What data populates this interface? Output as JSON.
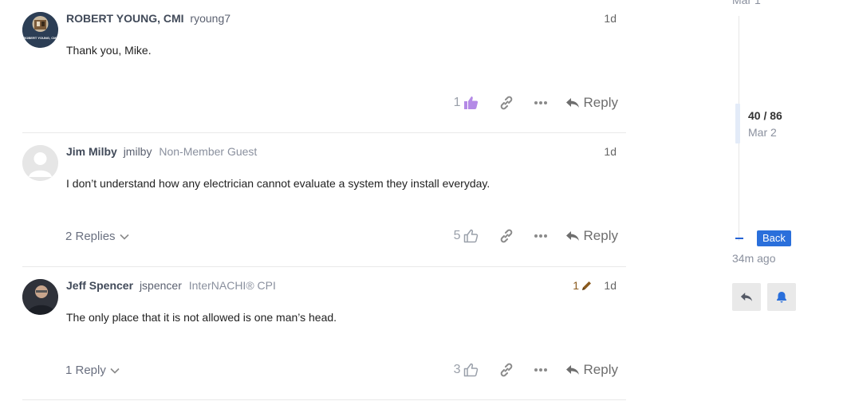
{
  "posts": [
    {
      "full_name": "ROBERT YOUNG, CMI",
      "username": "ryoung7",
      "title": "",
      "date": "1d",
      "avatar_text": "ROBERT YOUNG, CMI",
      "body": "Thank you, Mike.",
      "likes": "1",
      "liked": true,
      "replies": "",
      "reply_label": "Reply"
    },
    {
      "full_name": "Jim Milby",
      "username": "jmilby",
      "title": "Non-Member Guest",
      "date": "1d",
      "body": "I don’t understand how any electrician cannot evaluate a system they install everyday.",
      "likes": "5",
      "liked": false,
      "replies": "2 Replies",
      "reply_label": "Reply"
    },
    {
      "full_name": "Jeff Spencer",
      "username": "jspencer",
      "title": "InterNACHI® CPI",
      "date": "1d",
      "edits": "1",
      "body": "The only place that it is not allowed is one man’s head.",
      "likes": "3",
      "liked": false,
      "replies": "1 Reply",
      "reply_label": "Reply"
    }
  ],
  "timeline": {
    "start_date": "Mar 1",
    "position": "40 / 86",
    "position_date": "Mar 2",
    "back_label": "Back",
    "last_visit": "34m ago"
  },
  "colors": {
    "accent": "#2a6fdb",
    "liked": "#b48ae6",
    "muted": "#9aa0aa"
  }
}
